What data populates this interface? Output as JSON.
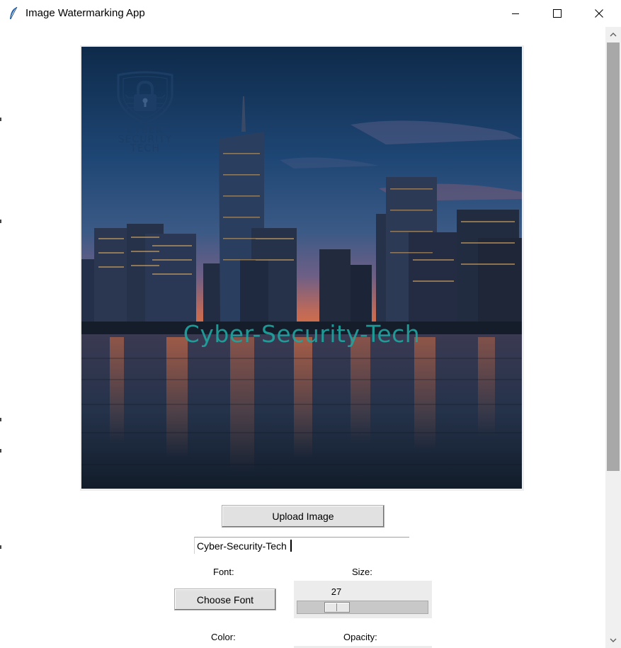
{
  "window": {
    "title": "Image Watermarking App",
    "icons": [
      "feather-icon",
      "minimize-icon",
      "maximize-icon",
      "close-icon"
    ]
  },
  "image": {
    "watermark_text": "Cyber-Security-Tech",
    "watermark_color": "#1ea6a0",
    "logo_lines": [
      "CYBER",
      "SECURITY",
      "TECH"
    ],
    "logo_color": "#1c3e66"
  },
  "controls": {
    "upload_label": "Upload Image",
    "entry_value": "Cyber-Security-Tech",
    "font_label": "Font:",
    "size_label": "Size:",
    "choose_font_label": "Choose Font",
    "size_value": "27",
    "color_label": "Color:",
    "opacity_label": "Opacity:"
  },
  "scrollbar": {
    "icons": [
      "scroll-up-arrow-icon",
      "scroll-down-arrow-icon"
    ]
  }
}
